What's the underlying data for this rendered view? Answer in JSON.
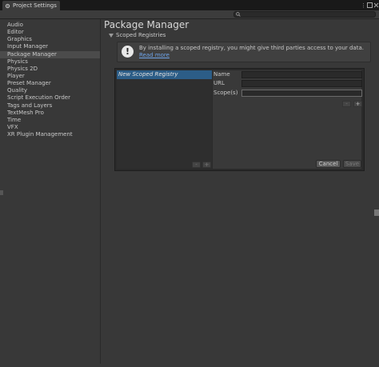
{
  "window": {
    "tab_title": "Project Settings",
    "controls": [
      "more-icon",
      "maximize-icon",
      "close-icon"
    ]
  },
  "search": {
    "placeholder": ""
  },
  "sidebar": {
    "items": [
      {
        "label": "Audio"
      },
      {
        "label": "Editor"
      },
      {
        "label": "Graphics"
      },
      {
        "label": "Input Manager"
      },
      {
        "label": "Package Manager",
        "selected": true
      },
      {
        "label": "Physics"
      },
      {
        "label": "Physics 2D"
      },
      {
        "label": "Player"
      },
      {
        "label": "Preset Manager"
      },
      {
        "label": "Quality"
      },
      {
        "label": "Script Execution Order"
      },
      {
        "label": "Tags and Layers"
      },
      {
        "label": "TextMesh Pro"
      },
      {
        "label": "Time"
      },
      {
        "label": "VFX"
      },
      {
        "label": "XR Plugin Management"
      }
    ]
  },
  "main": {
    "title": "Package Manager",
    "section_title": "Scoped Registries",
    "info_text": "By installing a scoped registry, you might give third parties access to your data.",
    "info_link": "Read more",
    "registry_list": [
      "New Scoped Registry"
    ],
    "form": {
      "name_label": "Name",
      "url_label": "URL",
      "scopes_label": "Scope(s)"
    },
    "buttons": {
      "remove": "-",
      "add": "+",
      "scope_remove": "-",
      "scope_add": "+",
      "cancel": "Cancel",
      "save": "Save"
    }
  },
  "colors": {
    "background": "#383838",
    "selection": "#2c5d87",
    "link": "#6ea3e8"
  }
}
